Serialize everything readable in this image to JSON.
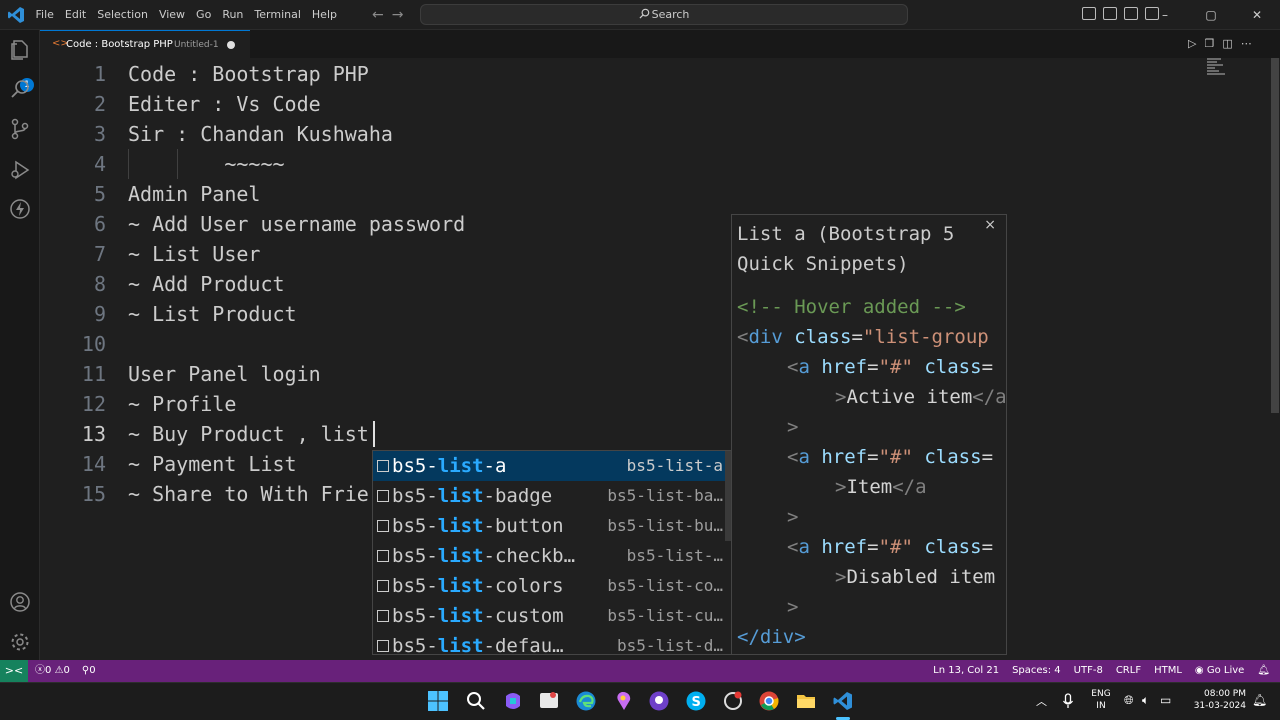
{
  "titlebar": {
    "menu": [
      "File",
      "Edit",
      "Selection",
      "View",
      "Go",
      "Run",
      "Terminal",
      "Help"
    ],
    "search_placeholder": "Search",
    "window_controls": {
      "minimize": "–",
      "maximize": "▢",
      "close": "✕"
    }
  },
  "activity_bar": {
    "items": [
      "explorer-icon",
      "search-icon",
      "source-control-icon",
      "run-debug-icon",
      "extensions-icon"
    ],
    "explorer_badge": "1",
    "bottom": [
      "accounts-icon",
      "manage-gear-icon"
    ]
  },
  "tab": {
    "title": "Code : Bootstrap PHP",
    "description": "Untitled-1",
    "dirty": true
  },
  "editor": {
    "lines": [
      {
        "n": "1",
        "text": "Code : Bootstrap PHP"
      },
      {
        "n": "2",
        "text": "Editer : Vs Code"
      },
      {
        "n": "3",
        "text": "Sir : Chandan Kushwaha"
      },
      {
        "n": "4",
        "text": "        ~~~~~"
      },
      {
        "n": "5",
        "text": "Admin Panel"
      },
      {
        "n": "6",
        "text": "~ Add User username password"
      },
      {
        "n": "7",
        "text": "~ List User"
      },
      {
        "n": "8",
        "text": "~ Add Product"
      },
      {
        "n": "9",
        "text": "~ List Product"
      },
      {
        "n": "10",
        "text": ""
      },
      {
        "n": "11",
        "text": "User Panel login"
      },
      {
        "n": "12",
        "text": "~ Profile"
      },
      {
        "n": "13",
        "text": "~ Buy Product , list"
      },
      {
        "n": "14",
        "text": "~ Payment List"
      },
      {
        "n": "15",
        "text": "~ Share to With Frie"
      }
    ],
    "active_line": 13
  },
  "suggest": {
    "items": [
      {
        "pre": "bs5-",
        "hl": "list",
        "post": "-a",
        "detail": "bs5-list-a",
        "selected": true
      },
      {
        "pre": "bs5-",
        "hl": "list",
        "post": "-badge",
        "detail": "bs5-list-ba…"
      },
      {
        "pre": "bs5-",
        "hl": "list",
        "post": "-button",
        "detail": "bs5-list-bu…"
      },
      {
        "pre": "bs5-",
        "hl": "list",
        "post": "-checkb…",
        "detail": "bs5-list-…"
      },
      {
        "pre": "bs5-",
        "hl": "list",
        "post": "-colors",
        "detail": "bs5-list-co…"
      },
      {
        "pre": "bs5-",
        "hl": "list",
        "post": "-custom",
        "detail": "bs5-list-cu…"
      },
      {
        "pre": "bs5-",
        "hl": "list",
        "post": "-defau…",
        "detail": "bs5-list-d…"
      }
    ]
  },
  "details": {
    "title": "List a (Bootstrap 5 Quick Snippets)",
    "close": "×",
    "code": {
      "comment": "<!-- Hover added -->",
      "div_open_tag": "div",
      "attr_class": "class",
      "div_class_value": "\"list-group",
      "a_tag": "a",
      "attr_href": "href",
      "href_value": "\"#\"",
      "item1_text": "Active item",
      "item2_text": "Item",
      "item3_text": "Disabled item",
      "div_close": "</div>"
    }
  },
  "statusbar": {
    "errors": "0",
    "warnings": "0",
    "ports": "0",
    "position": "Ln 13, Col 21",
    "spaces": "Spaces: 4",
    "encoding": "UTF-8",
    "eol": "CRLF",
    "language": "HTML",
    "go_live": "Go Live"
  },
  "taskbar": {
    "lang": "ENG",
    "region": "IN",
    "time": "08:00 PM",
    "date": "31-03-2024"
  },
  "colors": {
    "accent": "#0078d4",
    "statusbar": "#68217a",
    "remote": "#16825d",
    "highlight": "#2aaaff"
  }
}
